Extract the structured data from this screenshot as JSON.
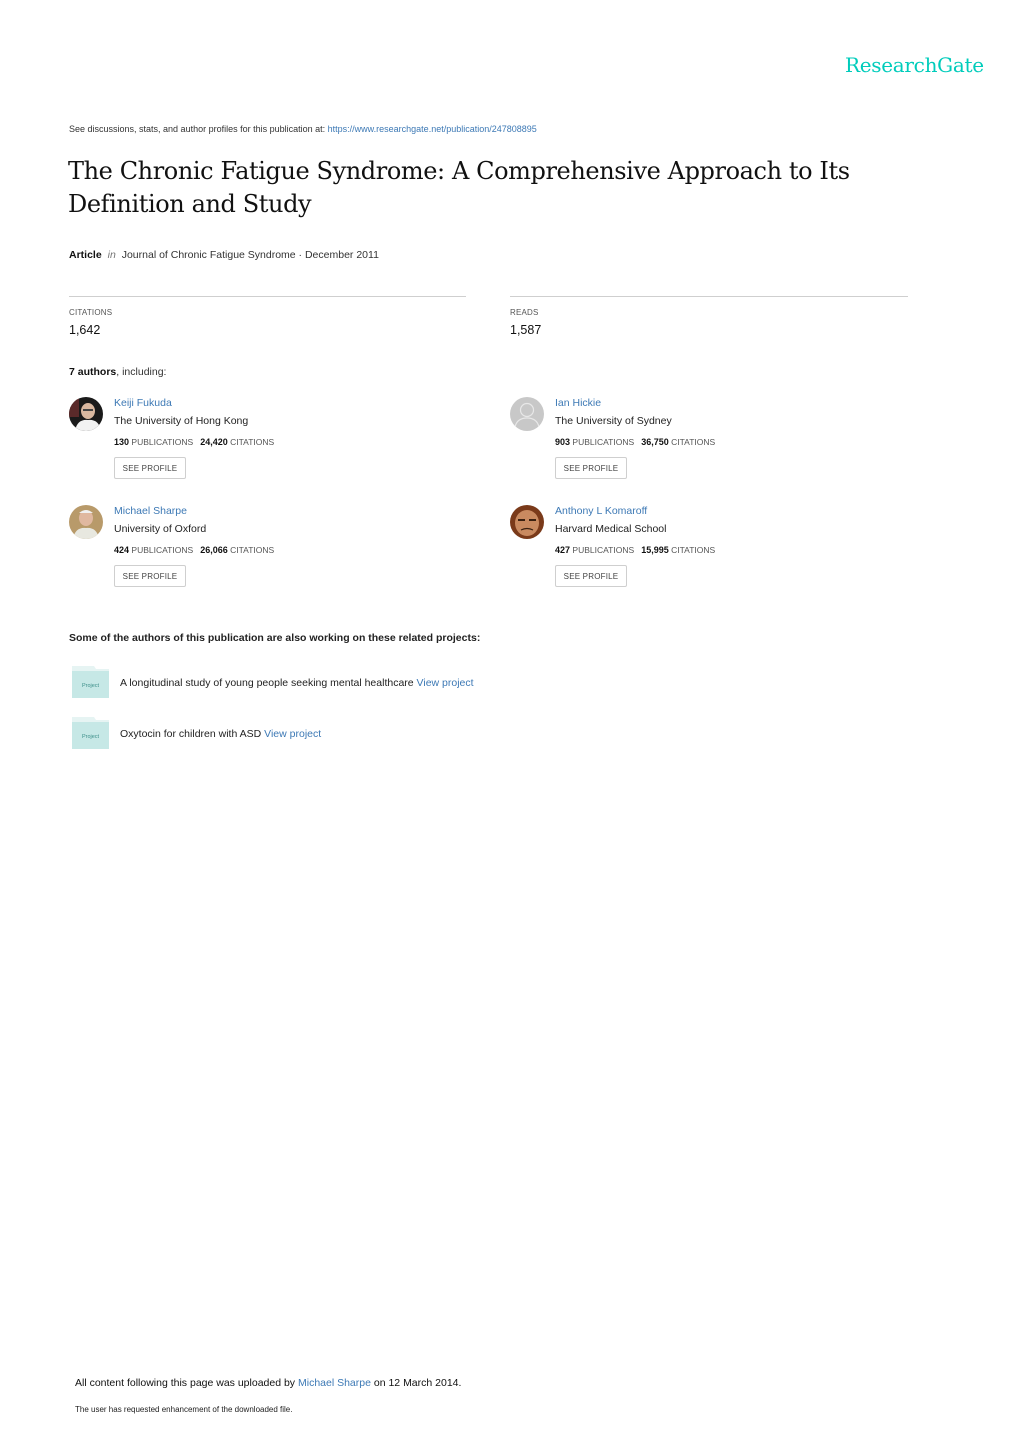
{
  "brand": {
    "logo_text": "ResearchGate",
    "accent_color": "#00ccbb",
    "link_color": "#3d79b5"
  },
  "header": {
    "see_discussions_text": "See discussions, stats, and author profiles for this publication at: ",
    "publication_url": "https://www.researchgate.net/publication/247808895"
  },
  "publication": {
    "title": "The Chronic Fatigue Syndrome: A Comprehensive Approach to Its Definition and Study",
    "type": "Article",
    "in_label": "in",
    "journal_date": "Journal of Chronic Fatigue Syndrome · December 2011"
  },
  "stats": {
    "citations_label": "CITATIONS",
    "citations_value": "1,642",
    "reads_label": "READS",
    "reads_value": "1,587"
  },
  "authors_section": {
    "count_text": "7 authors",
    "suffix": ", including:",
    "publications_label": "PUBLICATIONS",
    "citations_label": "CITATIONS",
    "see_profile_label": "SEE PROFILE",
    "authors": [
      {
        "name": "Keiji Fukuda",
        "institution": "The University of Hong Kong",
        "publications": "130",
        "citations": "24,420",
        "avatar": "photo"
      },
      {
        "name": "Ian Hickie",
        "institution": "The University of Sydney",
        "publications": "903",
        "citations": "36,750",
        "avatar": "placeholder"
      },
      {
        "name": "Michael Sharpe",
        "institution": "University of Oxford",
        "publications": "424",
        "citations": "26,066",
        "avatar": "photo"
      },
      {
        "name": "Anthony L Komaroff",
        "institution": "Harvard Medical School",
        "publications": "427",
        "citations": "15,995",
        "avatar": "photo"
      }
    ]
  },
  "projects_section": {
    "heading": "Some of the authors of this publication are also working on these related projects:",
    "folder_label": "Project",
    "view_label": "View project",
    "projects": [
      {
        "title": "A longitudinal study of young people seeking mental healthcare"
      },
      {
        "title": "Oxytocin for children with ASD"
      }
    ]
  },
  "footer": {
    "uploaded_prefix": "All content following this page was uploaded by ",
    "uploader": "Michael Sharpe",
    "uploaded_suffix": " on 12 March 2014.",
    "enhancement_note": "The user has requested enhancement of the downloaded file."
  }
}
